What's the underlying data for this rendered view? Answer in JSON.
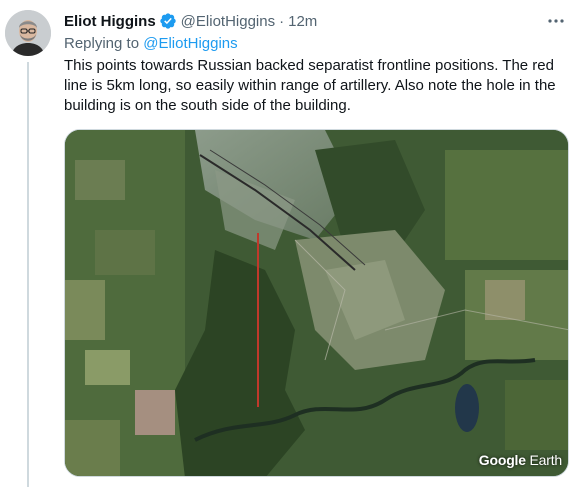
{
  "author": {
    "name": "Eliot Higgins",
    "handle": "@EliotHiggins",
    "separator": "·",
    "time": "12m",
    "verified": true
  },
  "reply": {
    "prefix": "Replying to",
    "mention": "@EliotHiggins"
  },
  "tweet_text": "This points towards Russian backed separatist frontline positions. The red line is 5km long, so easily within range of artillery. Also note the hole in the building is on the south side of the building.",
  "media": {
    "watermark_1": "Google",
    "watermark_2": "Earth",
    "annotation_line_color": "#c0392b"
  },
  "icons": {
    "verified": "verified-badge-icon",
    "more": "more-horizontal-icon"
  },
  "colors": {
    "link": "#1d9bf0",
    "verified": "#1d9bf0",
    "secondary_text": "#536471"
  }
}
